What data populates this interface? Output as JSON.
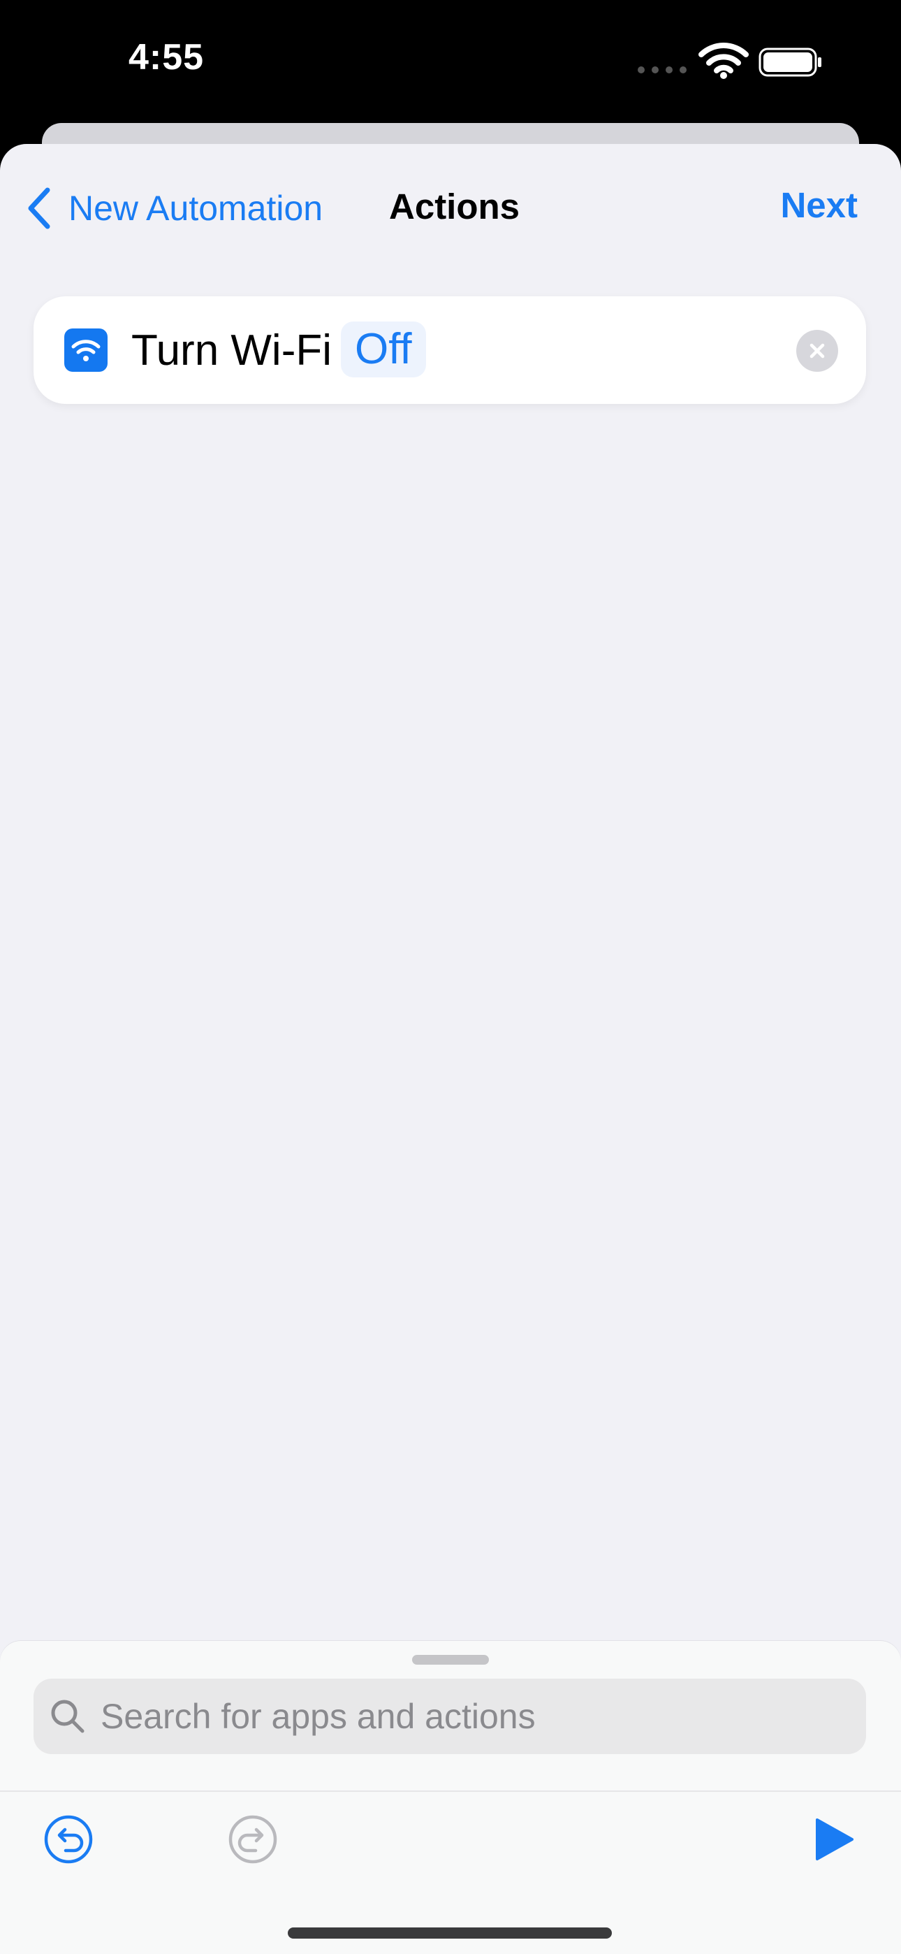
{
  "status_bar": {
    "time": "4:55"
  },
  "nav": {
    "back_label": "New Automation",
    "title": "Actions",
    "next_label": "Next"
  },
  "action": {
    "label": "Turn Wi-Fi",
    "parameter": "Off"
  },
  "search": {
    "placeholder": "Search for apps and actions",
    "value": ""
  },
  "colors": {
    "accent": "#1a7cf3",
    "background": "#f1f1f6",
    "card": "#ffffff"
  },
  "icons": {
    "back": "chevron-left-icon",
    "action": "wifi-icon",
    "remove": "close-icon",
    "search": "search-icon",
    "undo": "undo-icon",
    "redo": "redo-icon",
    "run": "play-icon"
  }
}
